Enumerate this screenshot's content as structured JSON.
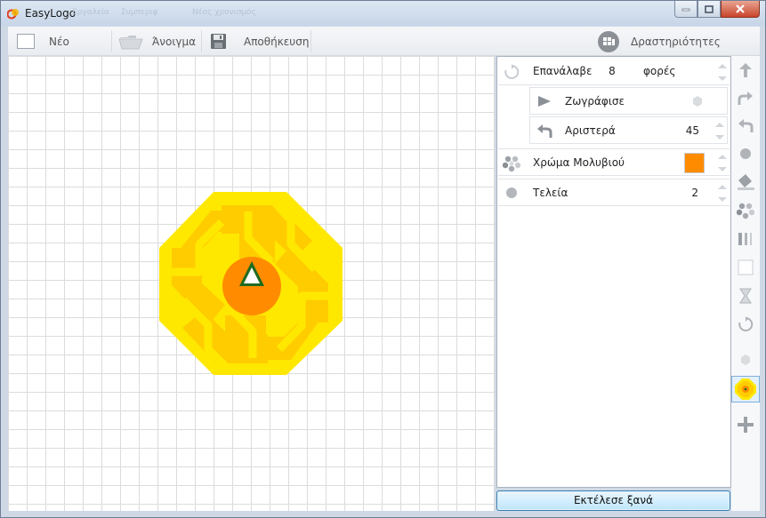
{
  "window": {
    "title": "EasyLogo",
    "ghost_menu": [
      "Εργαλεία",
      "Συμπεριφ",
      "Νέος χρονισμός"
    ]
  },
  "toolbar": {
    "new_label": "Νέο",
    "open_label": "Άνοιγμα",
    "save_label": "Αποθήκευση",
    "activities_label": "Δραστηριότητες"
  },
  "program": {
    "repeat": {
      "label": "Επανάλαβε",
      "count": "8",
      "suffix": "φορές"
    },
    "draw": {
      "label": "Ζωγράφισε"
    },
    "left": {
      "label": "Αριστερά",
      "value": "45"
    },
    "pen_color": {
      "label": "Χρώμα Μολυβιού",
      "color": "#ff8c00"
    },
    "dot": {
      "label": "Τελεία",
      "value": "2"
    }
  },
  "run_button": {
    "label": "Εκτέλεσε ξανά"
  },
  "palette": {
    "icons": [
      "arrow-up-icon",
      "redo-icon",
      "undo-icon",
      "dot-icon",
      "fill-icon",
      "colors-icon",
      "pen-width-icon",
      "blank-icon",
      "hourglass-icon",
      "repeat-icon",
      "hexagon-icon",
      "flower-icon",
      "plus-icon"
    ],
    "active": "flower-icon"
  },
  "colors": {
    "accent_orange": "#ff8c00",
    "yellow": "#ffe800",
    "gold": "#ffcc00",
    "turtle_green": "#1f6b1f"
  }
}
